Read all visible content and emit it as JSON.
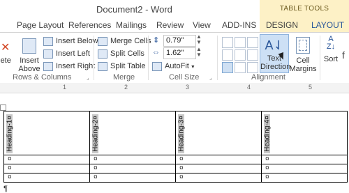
{
  "window": {
    "title": "Document2 - Word"
  },
  "contextual_tab_group": "TABLE TOOLS",
  "tabs": [
    {
      "label": "Page Layout"
    },
    {
      "label": "References"
    },
    {
      "label": "Mailings"
    },
    {
      "label": "Review"
    },
    {
      "label": "View"
    },
    {
      "label": "ADD-INS"
    },
    {
      "label": "DESIGN"
    },
    {
      "label": "LAYOUT"
    }
  ],
  "ribbon": {
    "rows_columns": {
      "label": "Rows & Columns",
      "delete_fragment": "lete",
      "insert_above": [
        "Insert",
        "Above"
      ],
      "insert_below": "Insert Below",
      "insert_left": "Insert Left",
      "insert_right": "Insert Right"
    },
    "merge": {
      "label": "Merge",
      "merge_cells": "Merge Cells",
      "split_cells": "Split Cells",
      "split_table": "Split Table"
    },
    "cell_size": {
      "label": "Cell Size",
      "height": "0.79\"",
      "width": "1.62\"",
      "autofit": "AutoFit"
    },
    "alignment": {
      "label": "Alignment",
      "text_direction": [
        "Text",
        "Direction"
      ],
      "cell_margins": [
        "Cell",
        "Margins"
      ]
    },
    "sort": "Sort"
  },
  "ruler": {
    "numbers": [
      "1",
      "2",
      "3",
      "4",
      "5"
    ]
  },
  "table": {
    "headers": [
      "Heading-1¤",
      "Heading-2¤",
      "Heading-3¤",
      "Heading-4¤"
    ],
    "cell_mark": "¤",
    "row_count": 3
  },
  "paragraph_mark": "¶"
}
